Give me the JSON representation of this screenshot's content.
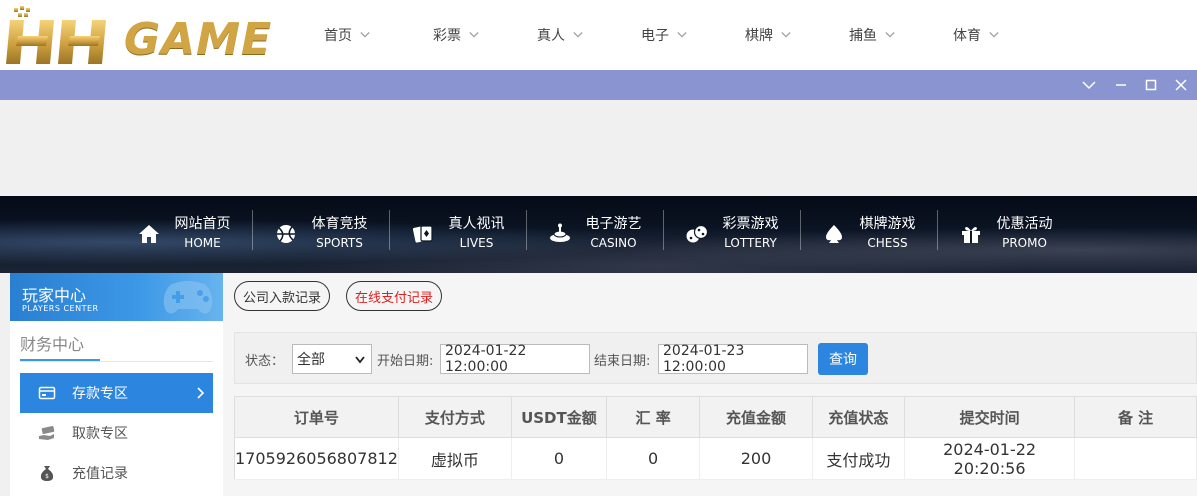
{
  "brand": {
    "logo_text": "HH GAME"
  },
  "top_nav": [
    {
      "label": "首页"
    },
    {
      "label": "彩票"
    },
    {
      "label": "真人"
    },
    {
      "label": "电子"
    },
    {
      "label": "棋牌"
    },
    {
      "label": "捕鱼"
    },
    {
      "label": "体育"
    }
  ],
  "categories": [
    {
      "cn": "网站首页",
      "en": "HOME",
      "icon": "home-icon"
    },
    {
      "cn": "体育竞技",
      "en": "SPORTS",
      "icon": "ball-icon"
    },
    {
      "cn": "真人视讯",
      "en": "LIVES",
      "icon": "cards-icon"
    },
    {
      "cn": "电子游艺",
      "en": "CASINO",
      "icon": "slot-icon"
    },
    {
      "cn": "彩票游戏",
      "en": "LOTTERY",
      "icon": "dice-icon"
    },
    {
      "cn": "棋牌游戏",
      "en": "CHESS",
      "icon": "spade-icon"
    },
    {
      "cn": "优惠活动",
      "en": "PROMO",
      "icon": "gift-icon"
    }
  ],
  "sidebar": {
    "players_center_cn": "玩家中心",
    "players_center_en": "PLAYERS CENTER",
    "finance_title": "财务中心",
    "items": [
      {
        "label": "存款专区",
        "active": true
      },
      {
        "label": "取款专区",
        "active": false
      },
      {
        "label": "充值记录",
        "active": false
      }
    ]
  },
  "tabs": [
    {
      "label": "公司入款记录"
    },
    {
      "label": "在线支付记录"
    }
  ],
  "filters": {
    "status_label": "状态：",
    "status_value": "全部",
    "start_label": "开始日期:",
    "start_value": "2024-01-22 12:00:00",
    "end_label": "结束日期:",
    "end_value": "2024-01-23 12:00:00",
    "query_label": "查询"
  },
  "table": {
    "headers": [
      "订单号",
      "支付方式",
      "USDT金额",
      "汇 率",
      "充值金额",
      "充值状态",
      "提交时间",
      "备 注"
    ],
    "rows": [
      [
        "1705926056807812",
        "虚拟币",
        "0",
        "0",
        "200",
        "支付成功",
        "2024-01-22 20:20:56",
        ""
      ]
    ]
  },
  "colors": {
    "accent": "#2c85de",
    "window_bar": "#8a94d0",
    "logo_gold": "#d2a544",
    "tab_red": "#e02020"
  }
}
